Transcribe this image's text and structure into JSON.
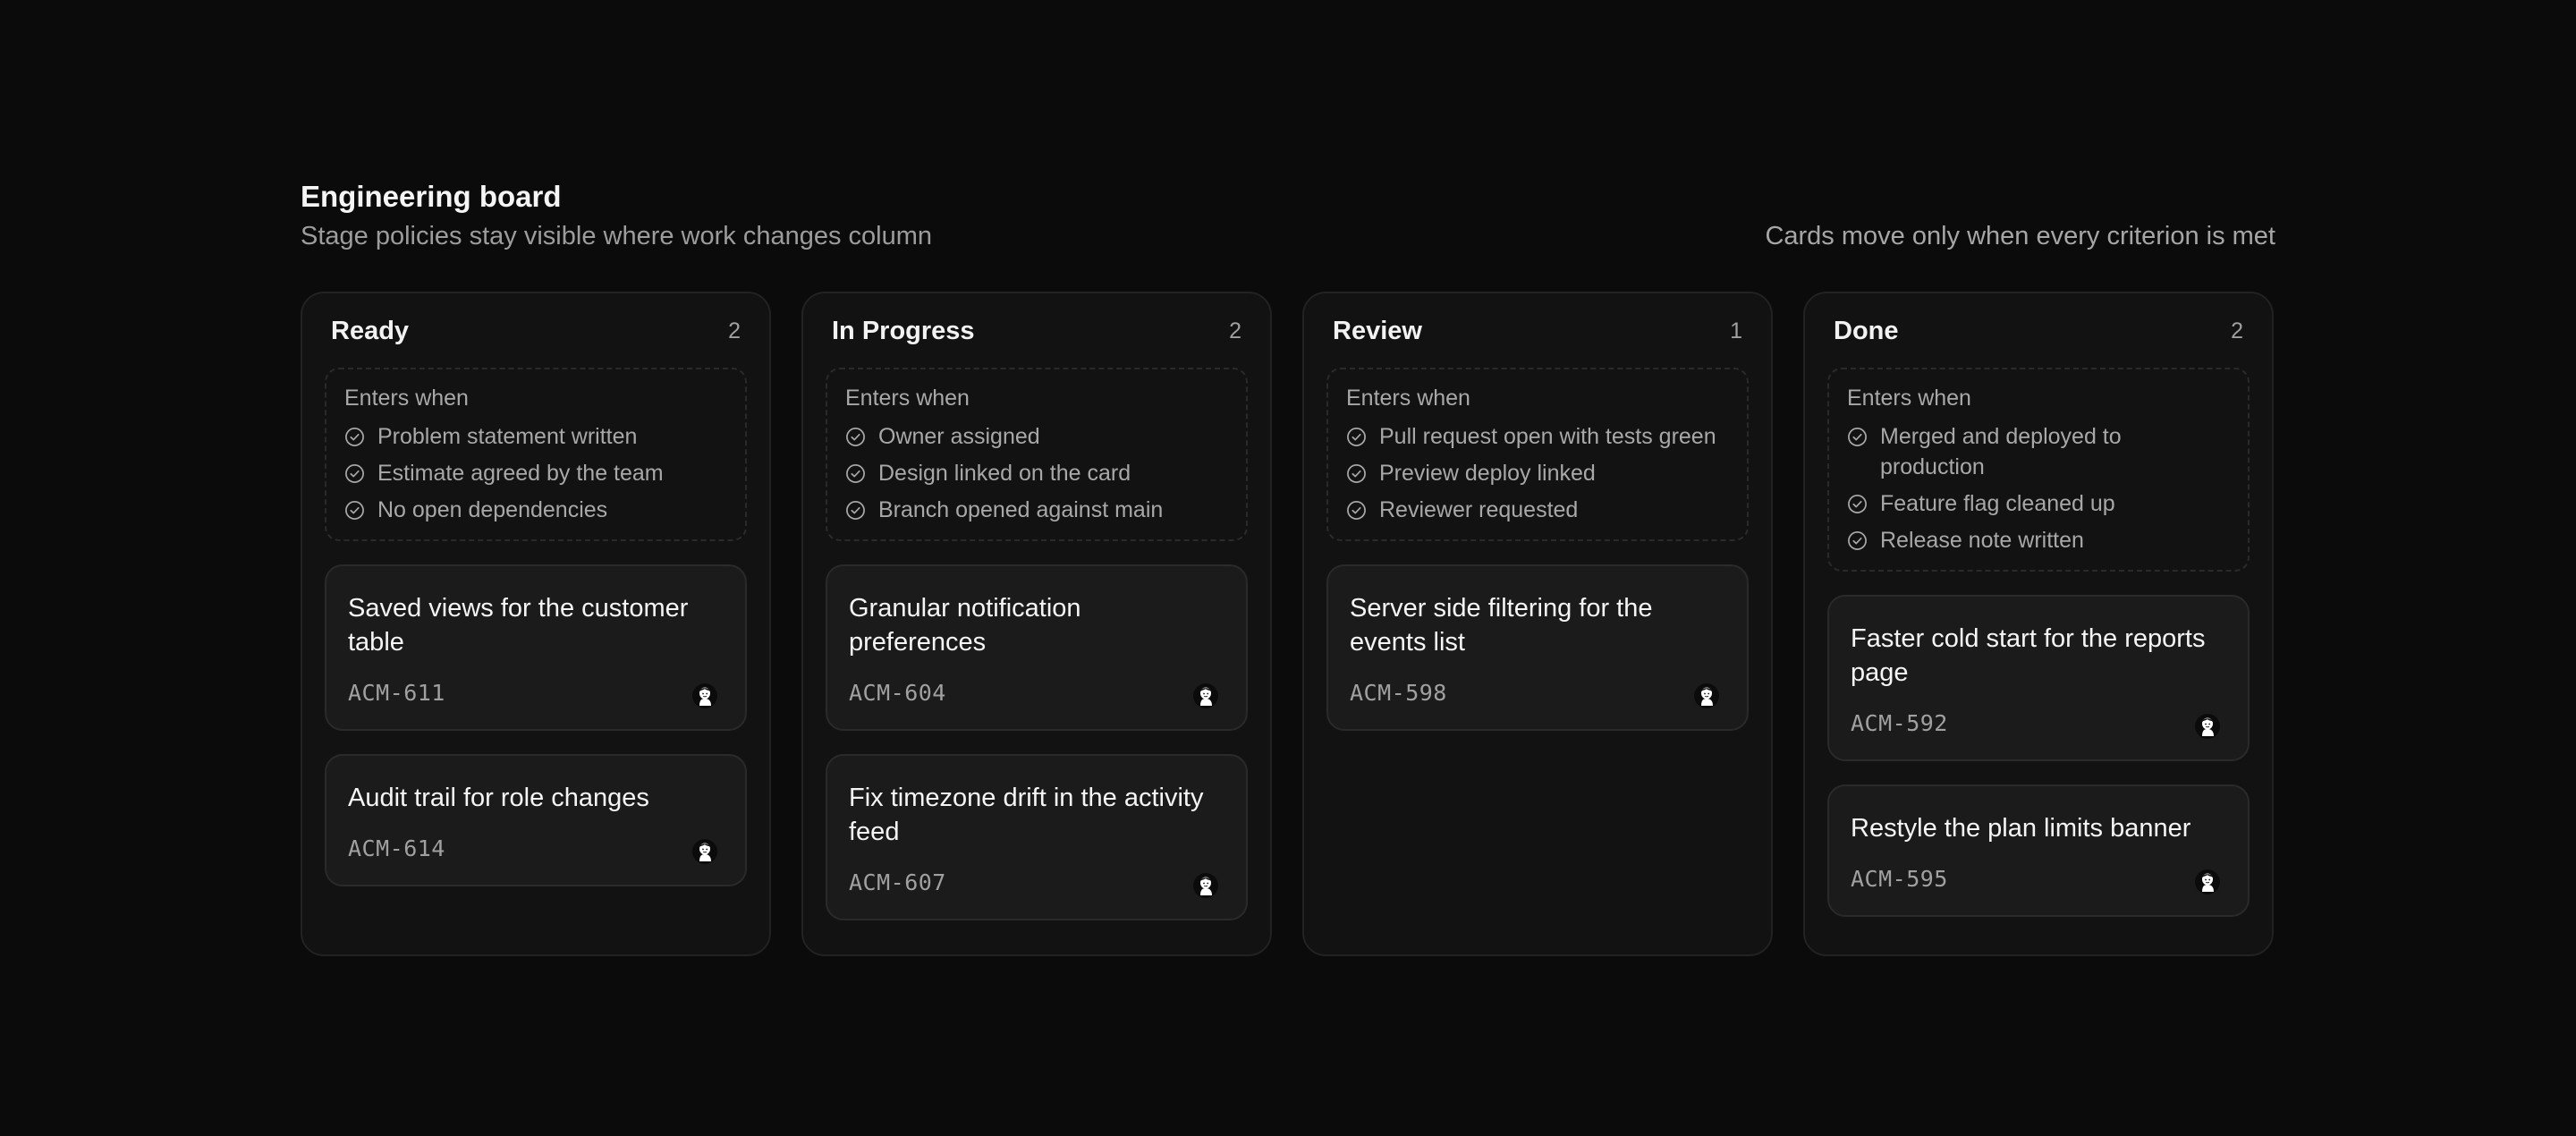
{
  "board": {
    "title": "Engineering board",
    "subtitle": "Stage policies stay visible where work changes column",
    "rule_note": "Cards move only when every criterion is met"
  },
  "icons": {
    "criterion": "check-circle-icon",
    "assignee": "avatar-icon"
  },
  "columns": [
    {
      "name": "Ready",
      "count": "2",
      "policy_label": "Enters when",
      "criteria": [
        "Problem statement written",
        "Estimate agreed by the team",
        "No open dependencies"
      ],
      "cards": [
        {
          "title": "Saved views for the customer table",
          "id": "ACM-611"
        },
        {
          "title": "Audit trail for role changes",
          "id": "ACM-614"
        }
      ]
    },
    {
      "name": "In Progress",
      "count": "2",
      "policy_label": "Enters when",
      "criteria": [
        "Owner assigned",
        "Design linked on the card",
        "Branch opened against main"
      ],
      "cards": [
        {
          "title": "Granular notification preferences",
          "id": "ACM-604"
        },
        {
          "title": "Fix timezone drift in the activity feed",
          "id": "ACM-607"
        }
      ]
    },
    {
      "name": "Review",
      "count": "1",
      "policy_label": "Enters when",
      "criteria": [
        "Pull request open with tests green",
        "Preview deploy linked",
        "Reviewer requested"
      ],
      "cards": [
        {
          "title": "Server side filtering for the events list",
          "id": "ACM-598"
        }
      ]
    },
    {
      "name": "Done",
      "count": "2",
      "policy_label": "Enters when",
      "criteria": [
        "Merged and deployed to production",
        "Feature flag cleaned up",
        "Release note written"
      ],
      "cards": [
        {
          "title": "Faster cold start for the reports page",
          "id": "ACM-592"
        },
        {
          "title": "Restyle the plan limits banner",
          "id": "ACM-595"
        }
      ]
    }
  ]
}
